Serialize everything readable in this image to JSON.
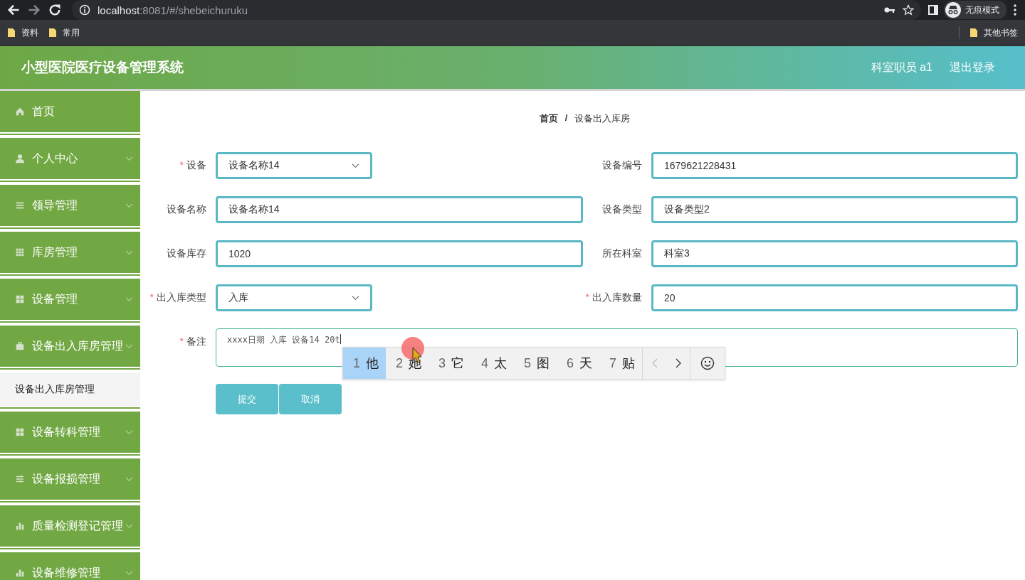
{
  "browser": {
    "url_host": "localhost",
    "url_path": ":8081/#/shebeichuruku",
    "forward_disabled": true,
    "profile_label": "无痕模式",
    "bookmarks": [
      "资料",
      "常用"
    ],
    "other_bookmarks": "其他书签"
  },
  "header": {
    "title": "小型医院医疗设备管理系统",
    "user": "科室职员 a1",
    "logout": "退出登录"
  },
  "sidebar": {
    "items": [
      {
        "label": "首页",
        "submenu": false
      },
      {
        "label": "个人中心",
        "submenu": true,
        "expanded": false
      },
      {
        "label": "领导管理",
        "submenu": true,
        "expanded": false
      },
      {
        "label": "库房管理",
        "submenu": true,
        "expanded": false
      },
      {
        "label": "设备管理",
        "submenu": true,
        "expanded": false
      },
      {
        "label": "设备出入库房管理",
        "submenu": true,
        "expanded": true,
        "children": [
          {
            "label": "设备出入库房管理",
            "selected": true
          }
        ]
      },
      {
        "label": "设备转科管理",
        "submenu": true,
        "expanded": false
      },
      {
        "label": "设备报损管理",
        "submenu": true,
        "expanded": false
      },
      {
        "label": "质量检测登记管理",
        "submenu": true,
        "expanded": false
      },
      {
        "label": "设备维修管理",
        "submenu": true,
        "expanded": false
      }
    ]
  },
  "breadcrumb": {
    "items": [
      "首页",
      "设备出入库房"
    ],
    "separator": "/"
  },
  "form": {
    "required_mark": "*",
    "rows": [
      [
        {
          "kind": "select",
          "label": "设备",
          "required": true,
          "value": "设备名称14"
        },
        {
          "kind": "input",
          "label": "设备编号",
          "required": false,
          "value": "1679621228431"
        }
      ],
      [
        {
          "kind": "input",
          "label": "设备名称",
          "required": false,
          "value": "设备名称14"
        },
        {
          "kind": "input",
          "label": "设备类型",
          "required": false,
          "value": "设备类型2"
        }
      ],
      [
        {
          "kind": "input",
          "label": "设备库存",
          "required": false,
          "value": "1020"
        },
        {
          "kind": "input",
          "label": "所在科室",
          "required": false,
          "value": "科室3"
        }
      ],
      [
        {
          "kind": "select",
          "label": "出入库类型",
          "required": true,
          "value": "入库"
        },
        {
          "kind": "input",
          "label": "出入库数量",
          "required": true,
          "value": "20"
        }
      ],
      [
        {
          "kind": "textarea",
          "label": "备注",
          "required": true,
          "value": "xxxx日期 入库 设备14 20t"
        }
      ]
    ],
    "buttons": [
      "提交",
      "取消"
    ]
  },
  "ime": {
    "candidates": [
      {
        "number": "1",
        "char": "他",
        "selected": true
      },
      {
        "number": "2",
        "char": "她",
        "selected": false
      },
      {
        "number": "3",
        "char": "它",
        "selected": false
      },
      {
        "number": "4",
        "char": "太",
        "selected": false
      },
      {
        "number": "5",
        "char": "图",
        "selected": false
      },
      {
        "number": "6",
        "char": "天",
        "selected": false
      },
      {
        "number": "7",
        "char": "贴",
        "selected": false
      }
    ],
    "prev_disabled": true
  }
}
